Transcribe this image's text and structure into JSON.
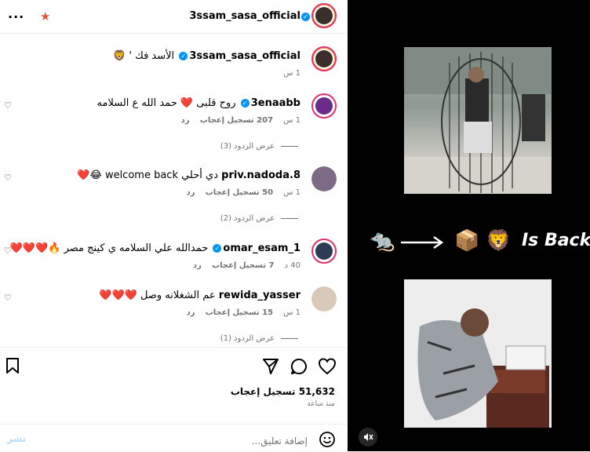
{
  "header": {
    "username": "3ssam_sasa_official",
    "more_icon": "more-horizontal-icon",
    "star_icon": "star-icon"
  },
  "caption": {
    "username": "3ssam_sasa_official",
    "text": "الأسد فك ' 🦁",
    "time": "1 س"
  },
  "comments": [
    {
      "username": "3enaabb",
      "text": "روح قلبى ❤️ حمد الله ع السلامه",
      "time": "1 س",
      "likes": "207 تسجيل إعجاب",
      "reply": "رد",
      "view_replies": "عرض الردود (3)"
    },
    {
      "username": "priv.nadoda.8",
      "text": "دي أحلي welcome back 😂❤️",
      "time": "1 س",
      "likes": "50 تسجيل إعجاب",
      "reply": "رد",
      "view_replies": "عرض الردود (2)"
    },
    {
      "username": "omar_esam_1",
      "text": "حمدالله علي السلامه ي كينج مصر 🔥❤️❤️❤️",
      "time": "40 د",
      "likes": "7 تسجيل إعجاب",
      "reply": "رد"
    },
    {
      "username": "rewida_yasser",
      "text": "عم الشغلانه وصل ❤️❤️❤️",
      "time": "1 س",
      "likes": "15 تسجيل إعجاب",
      "reply": "رد",
      "view_replies": "عرض الردود (1)"
    }
  ],
  "actions": {
    "likes_count": "51,632 تسجيل إعجاب",
    "time_ago": "منذ ساعة"
  },
  "comment_input": {
    "placeholder": "إضافة تعليق...",
    "post_label": "نشر"
  },
  "media": {
    "overlay_text": "Is Back",
    "mute_icon": "mute-icon"
  }
}
